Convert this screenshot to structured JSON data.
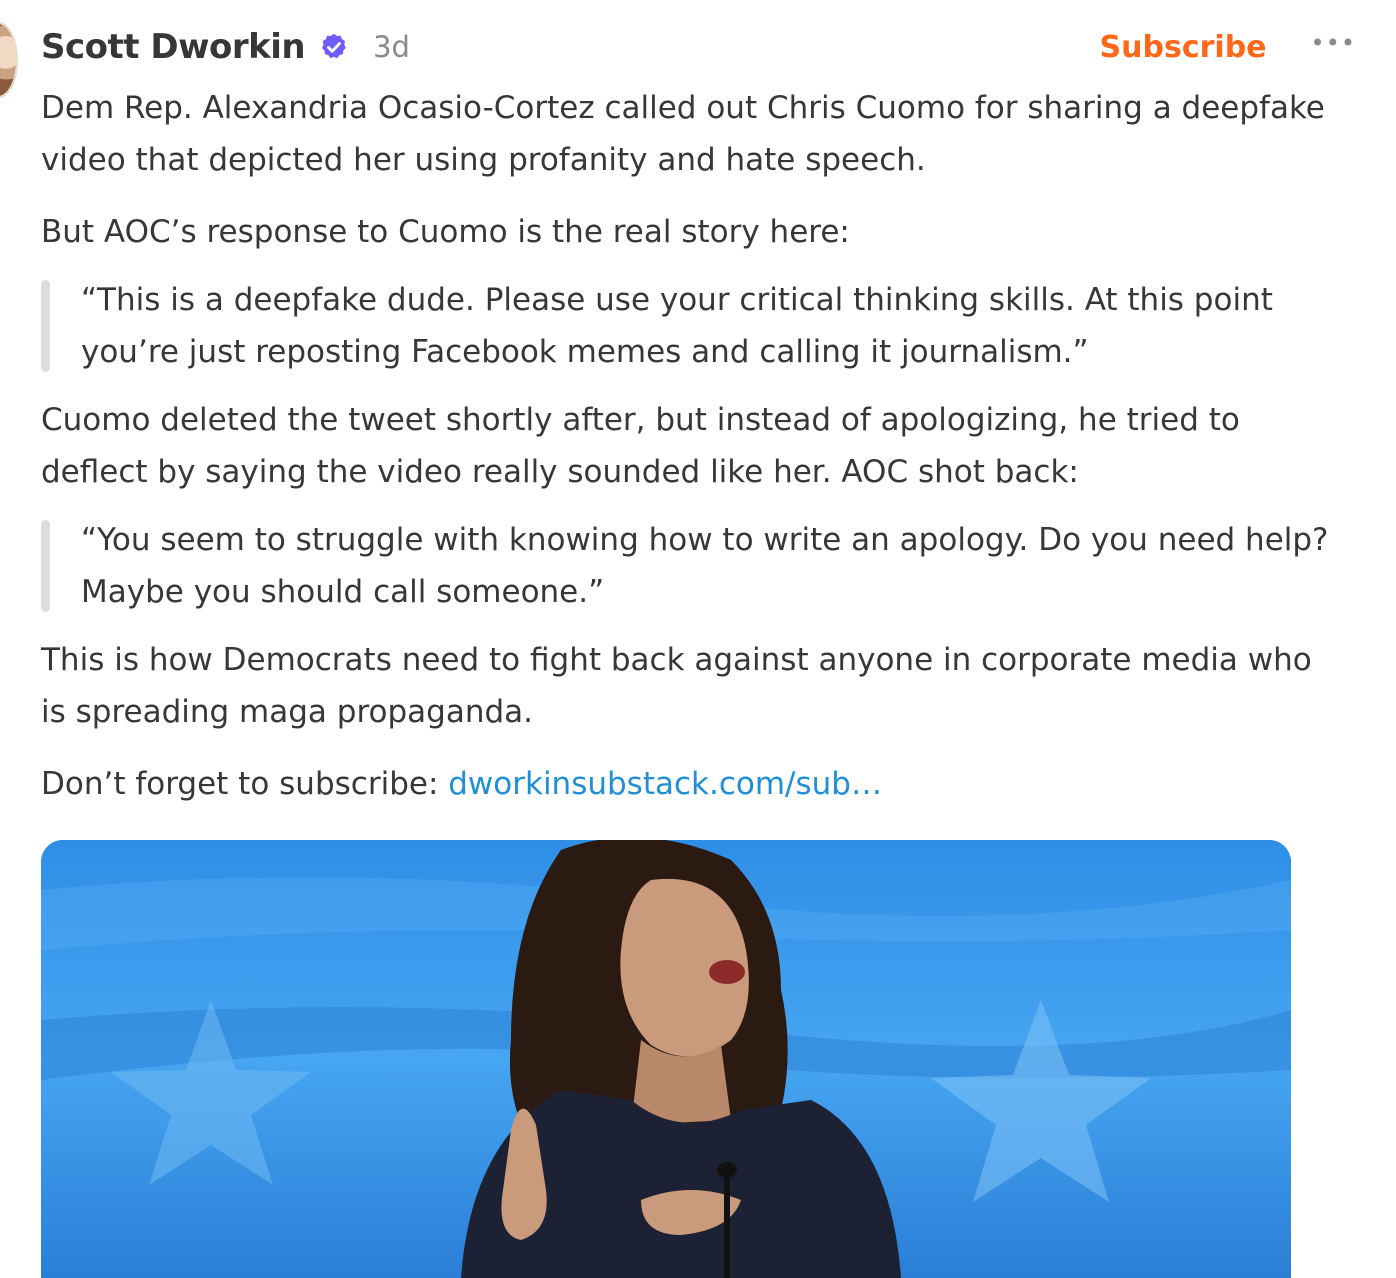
{
  "post": {
    "author": "Scott Dworkin",
    "time": "3d",
    "subscribe_label": "Subscribe",
    "more_label": "•••",
    "paragraphs": {
      "p1": "Dem Rep. Alexandria Ocasio-Cortez called out Chris Cuomo for sharing a deepfake video that depicted her using profanity and hate speech.",
      "p2": "But AOC’s response to Cuomo is the real story here:",
      "quote1": "“This is a deepfake dude. Please use your critical thinking skills. At this point you’re just reposting Facebook memes and calling it journalism.”",
      "p3": "Cuomo deleted the tweet shortly after, but instead of apologizing, he tried to deflect by saying the video really sounded like her. AOC shot back:",
      "quote2": "“You seem to struggle with knowing how to write an apology. Do you need help? Maybe you should call someone.”",
      "p4": "This is how Democrats need to fight back against anyone in corporate media who is spreading maga propaganda.",
      "p5_prefix": "Don’t forget to subscribe: ",
      "p5_link": "dworkinsubstack.com/sub…"
    }
  },
  "colors": {
    "accent": "#ff6719",
    "link": "#1f8fd6",
    "verified": "#6f5cff",
    "text": "#363737",
    "muted": "#8a8a8a"
  },
  "icons": {
    "verified": "verified-badge-icon",
    "more": "more-options-icon"
  }
}
